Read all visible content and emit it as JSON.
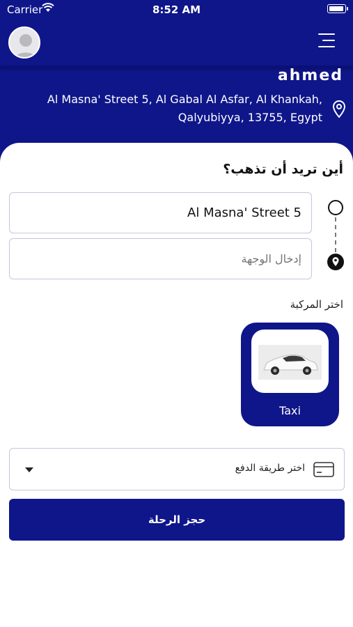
{
  "status_bar": {
    "carrier": "Carrier",
    "time": "8:52 AM"
  },
  "user": {
    "name": "ahmed",
    "address": "Al Masna' Street 5, Al Gabal Al Asfar, Al Khankah, Qalyubiyya, 13755, Egypt"
  },
  "trip": {
    "question": "أين تريد أن تذهب؟",
    "origin_value": "Al Masna' Street 5",
    "destination_placeholder": "إدخال الوجهة"
  },
  "vehicle": {
    "section_label": "اختر المركبة",
    "options": [
      {
        "name": "Taxi",
        "selected": true
      }
    ]
  },
  "payment": {
    "placeholder": "اختر طريقة الدفع"
  },
  "actions": {
    "book_label": "حجز الرحلة"
  },
  "colors": {
    "primary": "#0f168a",
    "border": "#c3c6dd",
    "white": "#ffffff"
  },
  "icons": [
    "wifi-icon",
    "battery-icon",
    "avatar-icon",
    "menu-icon",
    "location-pin-icon",
    "origin-circle-icon",
    "destination-pin-icon",
    "car-icon",
    "credit-card-icon",
    "chevron-down-icon"
  ]
}
